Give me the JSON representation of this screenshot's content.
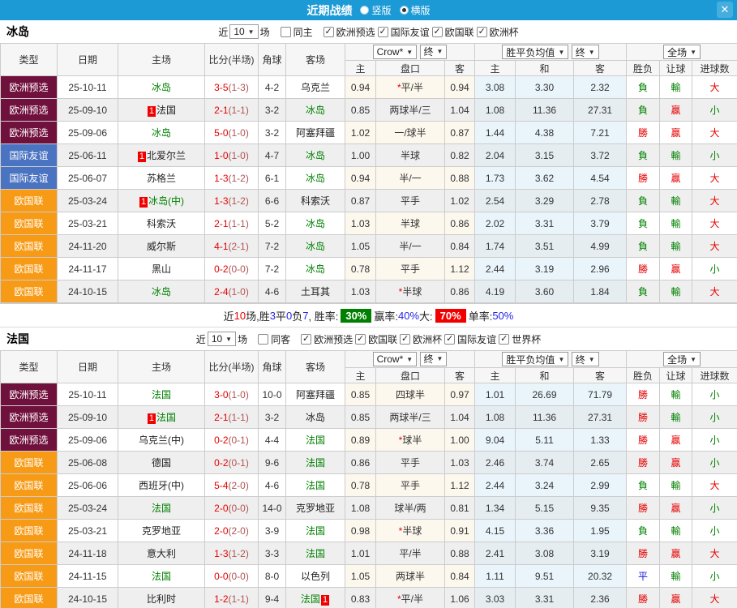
{
  "titlebar": {
    "title": "近期战绩",
    "radios": [
      {
        "label": "竖版",
        "checked": false
      },
      {
        "label": "横版",
        "checked": true
      }
    ],
    "close_icon": "✕"
  },
  "type_colors": {
    "欧洲预选": "#70103c",
    "国际友谊": "#4a73c2",
    "欧国联": "#f79b16"
  },
  "table_header": {
    "type": "类型",
    "date": "日期",
    "home": "主场",
    "score": "比分(半场)",
    "corner": "角球",
    "away": "客场",
    "crown_select": "Crow*",
    "final_select": "终",
    "avg_select": "胜平负均值",
    "final_select2": "终",
    "full_select": "全场",
    "sub": [
      "主",
      "盘口",
      "客",
      "主",
      "和",
      "客",
      "胜负",
      "让球",
      "进球数"
    ]
  },
  "sections": [
    {
      "team": "冰岛",
      "filter": {
        "prefix": "近",
        "count": "10",
        "suffix": "场",
        "same": {
          "label": "同主",
          "checked": false
        },
        "leagues": [
          {
            "label": "欧洲预选",
            "checked": true
          },
          {
            "label": "国际友谊",
            "checked": true
          },
          {
            "label": "欧国联",
            "checked": true
          },
          {
            "label": "欧洲杯",
            "checked": true
          }
        ]
      },
      "rows": [
        {
          "type": "欧洲预选",
          "date": "25-10-11",
          "home": {
            "name": "冰岛",
            "green": true
          },
          "score_ft": "3-5",
          "score_ht": "(1-3)",
          "corner": "4-2",
          "away": {
            "name": "乌克兰",
            "green": false
          },
          "o1": "0.94",
          "pan": "*平/半",
          "o2": "0.94",
          "m1": "3.08",
          "m2": "3.30",
          "m3": "2.32",
          "wl": {
            "t": "負",
            "c": "g"
          },
          "rq": {
            "t": "輸",
            "c": "g"
          },
          "jq": {
            "t": "大",
            "c": "r"
          }
        },
        {
          "type": "欧洲预选",
          "date": "25-09-10",
          "home": {
            "name": "法国",
            "green": false,
            "badge": "1"
          },
          "score_ft": "2-1",
          "score_ht": "(1-1)",
          "corner": "3-2",
          "away": {
            "name": "冰岛",
            "green": true
          },
          "o1": "0.85",
          "pan": "两球半/三",
          "o2": "1.04",
          "m1": "1.08",
          "m2": "11.36",
          "m3": "27.31",
          "wl": {
            "t": "負",
            "c": "g"
          },
          "rq": {
            "t": "贏",
            "c": "r"
          },
          "jq": {
            "t": "小",
            "c": "g"
          }
        },
        {
          "type": "欧洲预选",
          "date": "25-09-06",
          "home": {
            "name": "冰岛",
            "green": true
          },
          "score_ft": "5-0",
          "score_ht": "(1-0)",
          "corner": "3-2",
          "away": {
            "name": "阿塞拜疆",
            "green": false
          },
          "o1": "1.02",
          "pan": "一/球半",
          "o2": "0.87",
          "m1": "1.44",
          "m2": "4.38",
          "m3": "7.21",
          "wl": {
            "t": "勝",
            "c": "r"
          },
          "rq": {
            "t": "贏",
            "c": "r"
          },
          "jq": {
            "t": "大",
            "c": "r"
          }
        },
        {
          "type": "国际友谊",
          "date": "25-06-11",
          "home": {
            "name": "北爱尔兰",
            "green": false,
            "badge": "1"
          },
          "score_ft": "1-0",
          "score_ht": "(1-0)",
          "corner": "4-7",
          "away": {
            "name": "冰岛",
            "green": true
          },
          "o1": "1.00",
          "pan": "半球",
          "o2": "0.82",
          "m1": "2.04",
          "m2": "3.15",
          "m3": "3.72",
          "wl": {
            "t": "負",
            "c": "g"
          },
          "rq": {
            "t": "輸",
            "c": "g"
          },
          "jq": {
            "t": "小",
            "c": "g"
          }
        },
        {
          "type": "国际友谊",
          "date": "25-06-07",
          "home": {
            "name": "苏格兰",
            "green": false
          },
          "score_ft": "1-3",
          "score_ht": "(1-2)",
          "corner": "6-1",
          "away": {
            "name": "冰岛",
            "green": true
          },
          "o1": "0.94",
          "pan": "半/一",
          "o2": "0.88",
          "m1": "1.73",
          "m2": "3.62",
          "m3": "4.54",
          "wl": {
            "t": "勝",
            "c": "r"
          },
          "rq": {
            "t": "贏",
            "c": "r"
          },
          "jq": {
            "t": "大",
            "c": "r"
          }
        },
        {
          "type": "欧国联",
          "date": "25-03-24",
          "home": {
            "name": "冰岛(中)",
            "green": true,
            "badge": "1"
          },
          "score_ft": "1-3",
          "score_ht": "(1-2)",
          "corner": "6-6",
          "away": {
            "name": "科索沃",
            "green": false
          },
          "o1": "0.87",
          "pan": "平手",
          "o2": "1.02",
          "m1": "2.54",
          "m2": "3.29",
          "m3": "2.78",
          "wl": {
            "t": "負",
            "c": "g"
          },
          "rq": {
            "t": "輸",
            "c": "g"
          },
          "jq": {
            "t": "大",
            "c": "r"
          }
        },
        {
          "type": "欧国联",
          "date": "25-03-21",
          "home": {
            "name": "科索沃",
            "green": false
          },
          "score_ft": "2-1",
          "score_ht": "(1-1)",
          "corner": "5-2",
          "away": {
            "name": "冰岛",
            "green": true
          },
          "o1": "1.03",
          "pan": "半球",
          "o2": "0.86",
          "m1": "2.02",
          "m2": "3.31",
          "m3": "3.79",
          "wl": {
            "t": "負",
            "c": "g"
          },
          "rq": {
            "t": "輸",
            "c": "g"
          },
          "jq": {
            "t": "大",
            "c": "r"
          }
        },
        {
          "type": "欧国联",
          "date": "24-11-20",
          "home": {
            "name": "威尔斯",
            "green": false
          },
          "score_ft": "4-1",
          "score_ht": "(2-1)",
          "corner": "7-2",
          "away": {
            "name": "冰岛",
            "green": true
          },
          "o1": "1.05",
          "pan": "半/一",
          "o2": "0.84",
          "m1": "1.74",
          "m2": "3.51",
          "m3": "4.99",
          "wl": {
            "t": "負",
            "c": "g"
          },
          "rq": {
            "t": "輸",
            "c": "g"
          },
          "jq": {
            "t": "大",
            "c": "r"
          }
        },
        {
          "type": "欧国联",
          "date": "24-11-17",
          "home": {
            "name": "黑山",
            "green": false
          },
          "score_ft": "0-2",
          "score_ht": "(0-0)",
          "corner": "7-2",
          "away": {
            "name": "冰岛",
            "green": true
          },
          "o1": "0.78",
          "pan": "平手",
          "o2": "1.12",
          "m1": "2.44",
          "m2": "3.19",
          "m3": "2.96",
          "wl": {
            "t": "勝",
            "c": "r"
          },
          "rq": {
            "t": "贏",
            "c": "r"
          },
          "jq": {
            "t": "小",
            "c": "g"
          }
        },
        {
          "type": "欧国联",
          "date": "24-10-15",
          "home": {
            "name": "冰岛",
            "green": true
          },
          "score_ft": "2-4",
          "score_ht": "(1-0)",
          "corner": "4-6",
          "away": {
            "name": "土耳其",
            "green": false
          },
          "o1": "1.03",
          "pan": "*半球",
          "o2": "0.86",
          "m1": "4.19",
          "m2": "3.60",
          "m3": "1.84",
          "wl": {
            "t": "負",
            "c": "g"
          },
          "rq": {
            "t": "輸",
            "c": "g"
          },
          "jq": {
            "t": "大",
            "c": "r"
          }
        }
      ],
      "summary": [
        {
          "t": "近",
          "c": "k"
        },
        {
          "t": "10",
          "c": "r"
        },
        {
          "t": "场,胜",
          "c": "k"
        },
        {
          "t": "3",
          "c": "b"
        },
        {
          "t": "平",
          "c": "k"
        },
        {
          "t": "0",
          "c": "b"
        },
        {
          "t": "负",
          "c": "k"
        },
        {
          "t": "7",
          "c": "b"
        },
        {
          "t": ", 胜率:",
          "c": "k"
        },
        {
          "t": "30%",
          "badge": "green"
        },
        {
          "t": " 赢率:",
          "c": "k"
        },
        {
          "t": "40%",
          "c": "b"
        },
        {
          "t": " 大:",
          "c": "k"
        },
        {
          "t": "70%",
          "badge": "red"
        },
        {
          "t": " 单率:",
          "c": "k"
        },
        {
          "t": "50%",
          "c": "b"
        }
      ]
    },
    {
      "team": "法国",
      "filter": {
        "prefix": "近",
        "count": "10",
        "suffix": "场",
        "same": {
          "label": "同客",
          "checked": false
        },
        "leagues": [
          {
            "label": "欧洲预选",
            "checked": true
          },
          {
            "label": "欧国联",
            "checked": true
          },
          {
            "label": "欧洲杯",
            "checked": true
          },
          {
            "label": "国际友谊",
            "checked": true
          },
          {
            "label": "世界杯",
            "checked": true
          }
        ]
      },
      "rows": [
        {
          "type": "欧洲预选",
          "date": "25-10-11",
          "home": {
            "name": "法国",
            "green": true
          },
          "score_ft": "3-0",
          "score_ht": "(1-0)",
          "corner": "10-0",
          "away": {
            "name": "阿塞拜疆",
            "green": false
          },
          "o1": "0.85",
          "pan": "四球半",
          "o2": "0.97",
          "m1": "1.01",
          "m2": "26.69",
          "m3": "71.79",
          "wl": {
            "t": "勝",
            "c": "r"
          },
          "rq": {
            "t": "輸",
            "c": "g"
          },
          "jq": {
            "t": "小",
            "c": "g"
          }
        },
        {
          "type": "欧洲预选",
          "date": "25-09-10",
          "home": {
            "name": "法国",
            "green": true,
            "badge": "1"
          },
          "score_ft": "2-1",
          "score_ht": "(1-1)",
          "corner": "3-2",
          "away": {
            "name": "冰岛",
            "green": false
          },
          "o1": "0.85",
          "pan": "两球半/三",
          "o2": "1.04",
          "m1": "1.08",
          "m2": "11.36",
          "m3": "27.31",
          "wl": {
            "t": "勝",
            "c": "r"
          },
          "rq": {
            "t": "輸",
            "c": "g"
          },
          "jq": {
            "t": "小",
            "c": "g"
          }
        },
        {
          "type": "欧洲预选",
          "date": "25-09-06",
          "home": {
            "name": "乌克兰(中)",
            "green": false
          },
          "score_ft": "0-2",
          "score_ht": "(0-1)",
          "corner": "4-4",
          "away": {
            "name": "法国",
            "green": true
          },
          "o1": "0.89",
          "pan": "*球半",
          "o2": "1.00",
          "m1": "9.04",
          "m2": "5.11",
          "m3": "1.33",
          "wl": {
            "t": "勝",
            "c": "r"
          },
          "rq": {
            "t": "贏",
            "c": "r"
          },
          "jq": {
            "t": "小",
            "c": "g"
          }
        },
        {
          "type": "欧国联",
          "date": "25-06-08",
          "home": {
            "name": "德国",
            "green": false
          },
          "score_ft": "0-2",
          "score_ht": "(0-1)",
          "corner": "9-6",
          "away": {
            "name": "法国",
            "green": true
          },
          "o1": "0.86",
          "pan": "平手",
          "o2": "1.03",
          "m1": "2.46",
          "m2": "3.74",
          "m3": "2.65",
          "wl": {
            "t": "勝",
            "c": "r"
          },
          "rq": {
            "t": "贏",
            "c": "r"
          },
          "jq": {
            "t": "小",
            "c": "g"
          }
        },
        {
          "type": "欧国联",
          "date": "25-06-06",
          "home": {
            "name": "西班牙(中)",
            "green": false
          },
          "score_ft": "5-4",
          "score_ht": "(2-0)",
          "corner": "4-6",
          "away": {
            "name": "法国",
            "green": true
          },
          "o1": "0.78",
          "pan": "平手",
          "o2": "1.12",
          "m1": "2.44",
          "m2": "3.24",
          "m3": "2.99",
          "wl": {
            "t": "負",
            "c": "g"
          },
          "rq": {
            "t": "輸",
            "c": "g"
          },
          "jq": {
            "t": "大",
            "c": "r"
          }
        },
        {
          "type": "欧国联",
          "date": "25-03-24",
          "home": {
            "name": "法国",
            "green": true
          },
          "score_ft": "2-0",
          "score_ht": "(0-0)",
          "corner": "14-0",
          "away": {
            "name": "克罗地亚",
            "green": false
          },
          "o1": "1.08",
          "pan": "球半/两",
          "o2": "0.81",
          "m1": "1.34",
          "m2": "5.15",
          "m3": "9.35",
          "wl": {
            "t": "勝",
            "c": "r"
          },
          "rq": {
            "t": "贏",
            "c": "r"
          },
          "jq": {
            "t": "小",
            "c": "g"
          }
        },
        {
          "type": "欧国联",
          "date": "25-03-21",
          "home": {
            "name": "克罗地亚",
            "green": false
          },
          "score_ft": "2-0",
          "score_ht": "(2-0)",
          "corner": "3-9",
          "away": {
            "name": "法国",
            "green": true
          },
          "o1": "0.98",
          "pan": "*半球",
          "o2": "0.91",
          "m1": "4.15",
          "m2": "3.36",
          "m3": "1.95",
          "wl": {
            "t": "負",
            "c": "g"
          },
          "rq": {
            "t": "輸",
            "c": "g"
          },
          "jq": {
            "t": "小",
            "c": "g"
          }
        },
        {
          "type": "欧国联",
          "date": "24-11-18",
          "home": {
            "name": "意大利",
            "green": false
          },
          "score_ft": "1-3",
          "score_ht": "(1-2)",
          "corner": "3-3",
          "away": {
            "name": "法国",
            "green": true
          },
          "o1": "1.01",
          "pan": "平/半",
          "o2": "0.88",
          "m1": "2.41",
          "m2": "3.08",
          "m3": "3.19",
          "wl": {
            "t": "勝",
            "c": "r"
          },
          "rq": {
            "t": "贏",
            "c": "r"
          },
          "jq": {
            "t": "大",
            "c": "r"
          }
        },
        {
          "type": "欧国联",
          "date": "24-11-15",
          "home": {
            "name": "法国",
            "green": true
          },
          "score_ft": "0-0",
          "score_ht": "(0-0)",
          "corner": "8-0",
          "away": {
            "name": "以色列",
            "green": false
          },
          "o1": "1.05",
          "pan": "两球半",
          "o2": "0.84",
          "m1": "1.11",
          "m2": "9.51",
          "m3": "20.32",
          "wl": {
            "t": "平",
            "c": "b"
          },
          "rq": {
            "t": "輸",
            "c": "g"
          },
          "jq": {
            "t": "小",
            "c": "g"
          }
        },
        {
          "type": "欧国联",
          "date": "24-10-15",
          "home": {
            "name": "比利时",
            "green": false
          },
          "score_ft": "1-2",
          "score_ht": "(1-1)",
          "corner": "9-4",
          "away": {
            "name": "法国",
            "green": true,
            "badge": "1",
            "badge_after": true
          },
          "o1": "0.83",
          "pan": "*平/半",
          "o2": "1.06",
          "m1": "3.03",
          "m2": "3.31",
          "m3": "2.36",
          "wl": {
            "t": "勝",
            "c": "r"
          },
          "rq": {
            "t": "贏",
            "c": "r"
          },
          "jq": {
            "t": "大",
            "c": "r"
          }
        }
      ],
      "summary": null
    }
  ]
}
